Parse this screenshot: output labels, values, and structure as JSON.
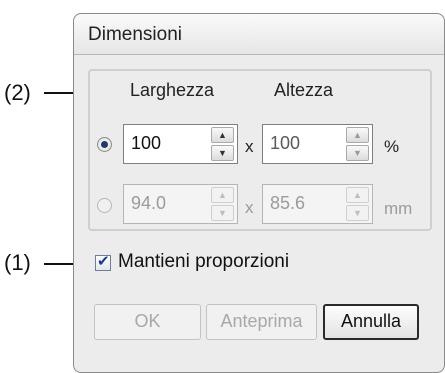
{
  "callouts": {
    "group": "(2)",
    "checkbox": "(1)"
  },
  "dialog": {
    "title": "Dimensioni",
    "columns": {
      "width": "Larghezza",
      "height": "Altezza"
    },
    "row_percent": {
      "selected": true,
      "width_value": "100",
      "height_value": "100",
      "separator": "x",
      "unit": "%"
    },
    "row_mm": {
      "selected": false,
      "width_value": "94.0",
      "height_value": "85.6",
      "separator": "x",
      "unit": "mm"
    },
    "keep_proportions": {
      "checked": true,
      "label": "Mantieni proporzioni"
    },
    "buttons": {
      "ok": "OK",
      "preview": "Anteprima",
      "cancel": "Annulla"
    }
  }
}
